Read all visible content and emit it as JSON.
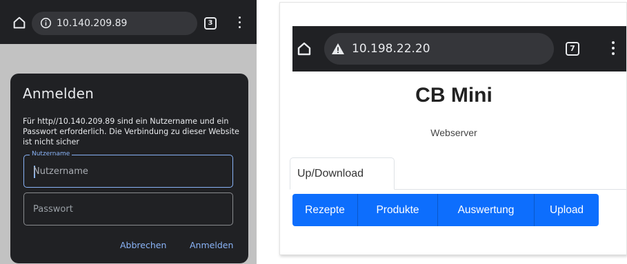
{
  "left_screen": {
    "toolbar": {
      "home_icon": "home-icon",
      "info_icon": "info-icon",
      "url": "10.140.209.89",
      "tab_count": "3",
      "menu_icon": "kebab-menu-icon"
    },
    "dialog": {
      "title": "Anmelden",
      "message": "Für http//10.140.209.89 sind ein Nutzername und ein Passwort erforderlich. Die Verbindung zu dieser Website ist nicht sicher",
      "username_legend": "Nutzername",
      "username_placeholder": "Nutzername",
      "password_placeholder": "Passwort",
      "cancel_label": "Abbrechen",
      "login_label": "Anmelden"
    }
  },
  "right_screen": {
    "toolbar": {
      "home_icon": "home-icon",
      "warning_icon": "warning-icon",
      "url": "10.198.22.20",
      "tab_count": "7",
      "menu_icon": "kebab-menu-icon"
    },
    "page": {
      "title": "CB Mini",
      "subtitle": "Webserver",
      "tab_label": "Up/Download",
      "buttons": [
        "Rezepte",
        "Produkte",
        "Auswertung",
        "Upload"
      ]
    }
  },
  "colors": {
    "chrome_dark": "#202124",
    "url_pill": "#35363a",
    "accent_blue": "#8ab4f8",
    "button_blue": "#0d6efd"
  }
}
